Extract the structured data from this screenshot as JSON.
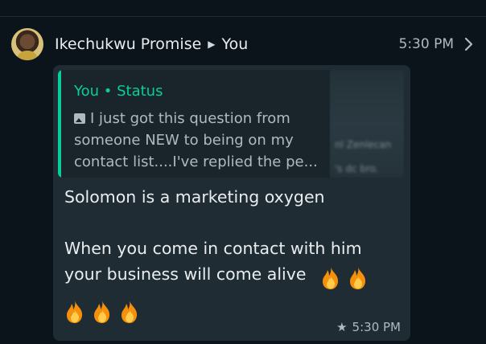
{
  "header": {
    "sender": "Ikechukwu Promise",
    "recipient": "You",
    "time": "5:30 PM"
  },
  "quote": {
    "title": "You • Status",
    "text": "I just got this question from someone NEW to being on my contact list....I've replied the pe..."
  },
  "message": {
    "line1": "Solomon is a marketing oxygen",
    "line2": "When you come in contact with him your business will come alive",
    "emoji_inline_count": 2,
    "emoji_row_count": 3,
    "emoji": "fire-emoji"
  },
  "footer": {
    "time": "5:30 PM",
    "starred": true
  },
  "colors": {
    "background": "#0b141a",
    "bubble": "#202c33",
    "quote_accent": "#06cf9c",
    "text": "#e9edef",
    "muted": "#aebac1"
  }
}
